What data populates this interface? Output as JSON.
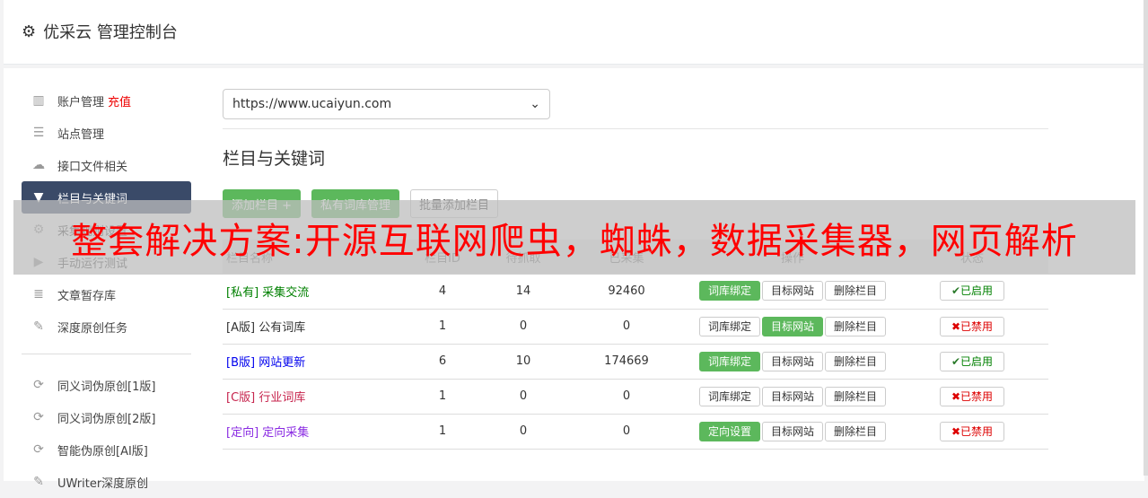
{
  "header": {
    "title": "优采云 管理控制台",
    "icon": "gear-icon"
  },
  "sidebar": {
    "items": [
      {
        "label": "账户管理",
        "extra": "充值",
        "icon": "bar-chart-icon",
        "glyph": "▥"
      },
      {
        "label": "站点管理",
        "icon": "server-icon",
        "glyph": "☰"
      },
      {
        "label": "接口文件相关",
        "icon": "cloud-upload-icon",
        "glyph": "☁"
      },
      {
        "label": "栏目与关键词",
        "icon": "filter-icon",
        "glyph": "▼",
        "active": true
      },
      {
        "label": "采集规则设置",
        "icon": "gears-icon",
        "glyph": "⚙"
      },
      {
        "label": "手动运行测试",
        "icon": "play-circle-icon",
        "glyph": "▶"
      },
      {
        "label": "文章暂存库",
        "icon": "database-icon",
        "glyph": "≣"
      },
      {
        "label": "深度原创任务",
        "icon": "edit-icon",
        "glyph": "✎"
      }
    ],
    "items2": [
      {
        "label": "同义词伪原创[1版]",
        "icon": "refresh-icon",
        "glyph": "⟳"
      },
      {
        "label": "同义词伪原创[2版]",
        "icon": "refresh-icon",
        "glyph": "⟳"
      },
      {
        "label": "智能伪原创[AI版]",
        "icon": "refresh-icon",
        "glyph": "⟳"
      },
      {
        "label": "UWriter深度原创",
        "icon": "edit-icon",
        "glyph": "✎"
      }
    ]
  },
  "main": {
    "site_select": "https://www.ucaiyun.com",
    "title": "栏目与关键词",
    "buttons": {
      "add": "添加栏目 +",
      "private": "私有词库管理",
      "batch": "批量添加栏目"
    },
    "columns": [
      "栏目名称",
      "栏目ID",
      "待抓取",
      "已采集",
      "操作",
      "状态"
    ],
    "rows": [
      {
        "tag": "[私有]",
        "name": "采集交流",
        "color": "#008000",
        "id": "4",
        "pending": "14",
        "collected": "92460",
        "op1": "词库绑定",
        "op1_active": true,
        "op2": "目标网站",
        "op2_active": false,
        "op3": "删除栏目",
        "status": "已启用",
        "enabled": true
      },
      {
        "tag": "[A版]",
        "name": "公有词库",
        "color": "#333333",
        "id": "1",
        "pending": "0",
        "collected": "0",
        "op1": "词库绑定",
        "op1_active": false,
        "op2": "目标网站",
        "op2_active": true,
        "op3": "删除栏目",
        "status": "已禁用",
        "enabled": false
      },
      {
        "tag": "[B版]",
        "name": "网站更新",
        "color": "#0000ee",
        "id": "6",
        "pending": "10",
        "collected": "174669",
        "op1": "词库绑定",
        "op1_active": true,
        "op2": "目标网站",
        "op2_active": false,
        "op3": "删除栏目",
        "status": "已启用",
        "enabled": true
      },
      {
        "tag": "[C版]",
        "name": "行业词库",
        "color": "#c7254e",
        "id": "1",
        "pending": "0",
        "collected": "0",
        "op1": "词库绑定",
        "op1_active": false,
        "op2": "目标网站",
        "op2_active": false,
        "op3": "删除栏目",
        "status": "已禁用",
        "enabled": false
      },
      {
        "tag": "[定向]",
        "name": "定向采集",
        "color": "#8a2be2",
        "id": "1",
        "pending": "0",
        "collected": "0",
        "op1": "定向设置",
        "op1_active": true,
        "op2": "目标网站",
        "op2_active": false,
        "op3": "删除栏目",
        "status": "已禁用",
        "enabled": false
      }
    ]
  },
  "overlay": {
    "text": "整套解决方案:开源互联网爬虫，蜘蛛，数据采集器，网页解析"
  }
}
